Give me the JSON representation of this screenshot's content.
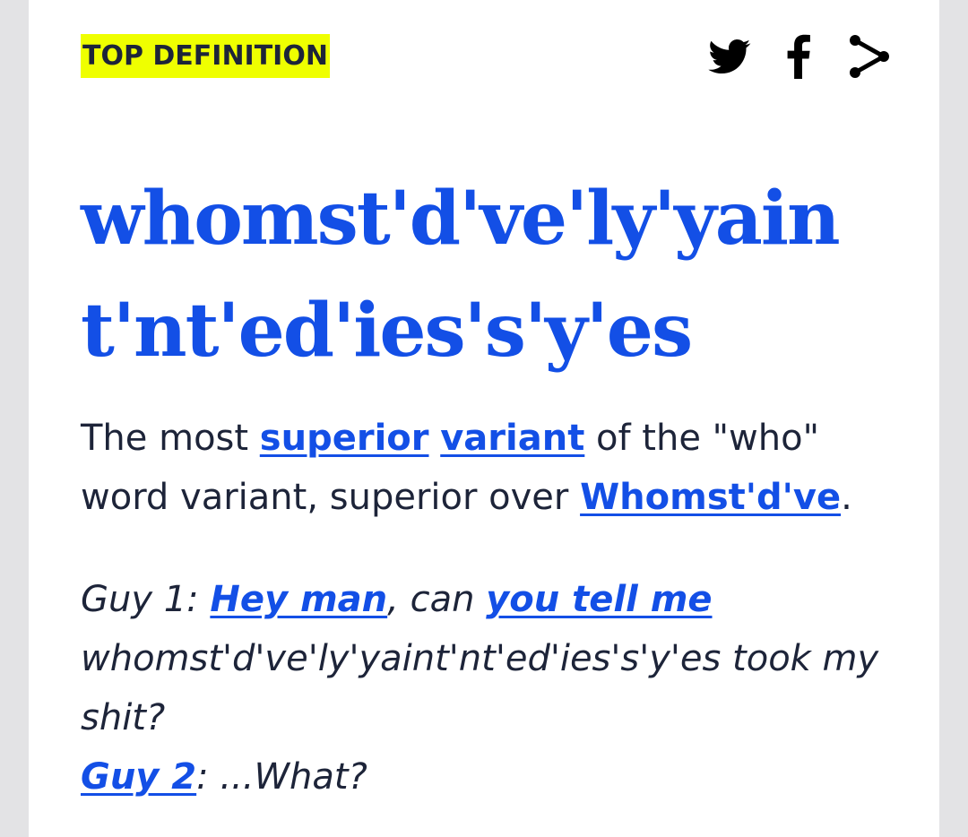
{
  "badge": "TOP DEFINITION",
  "share": {
    "icons": [
      "twitter-icon",
      "facebook-icon",
      "share-icon"
    ],
    "colors": {
      "icon": "#000000"
    }
  },
  "entry": {
    "word_line1": "whomst'd've'ly'yain",
    "word_line2": "t'nt'ed'ies's'y'es",
    "meaning": {
      "t1": "The most ",
      "link1": "superior",
      "t2": " ",
      "link2": "variant",
      "t3": " of the \"who\" word variant, superior over ",
      "link3": "Whomst'd've",
      "t4": "."
    },
    "example": {
      "t1": "Guy 1: ",
      "link1": "Hey man",
      "t2": ", can ",
      "link2": "you tell me",
      "t3": " whomst'd've'ly'yaint'nt'ed'ies's'y'es took my shit?",
      "link3": "Guy 2",
      "t4": ": ...What?"
    }
  },
  "colors": {
    "accent": "#134fe6",
    "badge_bg": "#efff00",
    "text": "#1d2439",
    "page_bg": "#e3e3e5"
  }
}
